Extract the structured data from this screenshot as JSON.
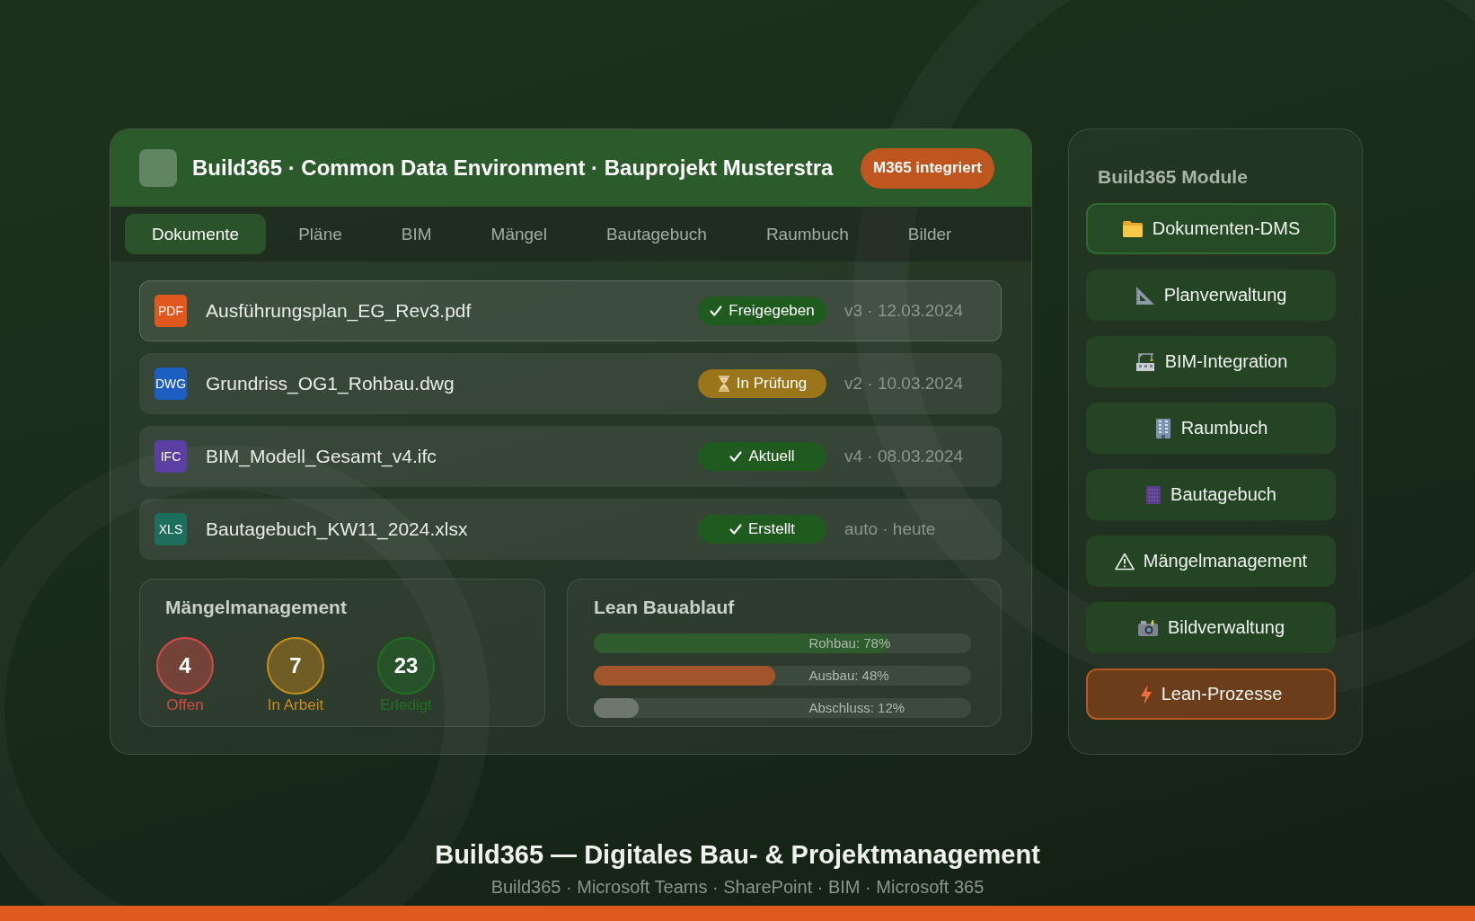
{
  "header": {
    "title": "Build365 · Common Data Environment · Bauprojekt Musterstra",
    "badge": "M365 integriert"
  },
  "tabs": [
    {
      "label": "Dokumente",
      "selected": true
    },
    {
      "label": "Pläne",
      "selected": false
    },
    {
      "label": "BIM",
      "selected": false
    },
    {
      "label": "Mängel",
      "selected": false
    },
    {
      "label": "Bautagebuch",
      "selected": false
    },
    {
      "label": "Raumbuch",
      "selected": false
    },
    {
      "label": "Bilder",
      "selected": false
    }
  ],
  "documents": [
    {
      "type_label": "PDF",
      "color": "#e0581e",
      "name": "Ausführungsplan_EG_Rev3.pdf",
      "status": {
        "kind": "done",
        "label": "Freigegeben"
      },
      "meta": "v3 · 12.03.2024",
      "selected": true
    },
    {
      "type_label": "DWG",
      "color": "#1c5fc0",
      "name": "Grundriss_OG1_Rohbau.dwg",
      "status": {
        "kind": "pending",
        "label": "In Prüfung"
      },
      "meta": "v2 · 10.03.2024",
      "selected": false
    },
    {
      "type_label": "IFC",
      "color": "#5b3fa2",
      "name": "BIM_Modell_Gesamt_v4.ifc",
      "status": {
        "kind": "done",
        "label": "Aktuell"
      },
      "meta": "v4 · 08.03.2024",
      "selected": false
    },
    {
      "type_label": "XLS",
      "color": "#1d6e5c",
      "name": "Bautagebuch_KW11_2024.xlsx",
      "status": {
        "kind": "done",
        "label": "Erstellt"
      },
      "meta": "auto · heute",
      "selected": false
    }
  ],
  "defects": {
    "title": "Mängelmanagement",
    "counters": [
      {
        "count": "4",
        "label": "Offen",
        "color": "#d44a48"
      },
      {
        "count": "7",
        "label": "In Arbeit",
        "color": "#c98d1a"
      },
      {
        "count": "23",
        "label": "Erledigt",
        "color": "#1f7022"
      }
    ]
  },
  "lean": {
    "title": "Lean Bauablauf",
    "bars": [
      {
        "label": "Rohbau: 78%",
        "level": 0.78,
        "color": "#2f5c2f"
      },
      {
        "label": "Ausbau: 48%",
        "level": 0.48,
        "color": "#a2552a"
      },
      {
        "label": "Abschluss: 12%",
        "level": 0.12,
        "color": "#6e776e"
      }
    ]
  },
  "sidebar": {
    "title": "Build365 Module",
    "items": [
      {
        "label": "Dokumenten-DMS",
        "selected": true,
        "highlighted": false
      },
      {
        "label": "Planverwaltung",
        "selected": false,
        "highlighted": false
      },
      {
        "label": "BIM-Integration",
        "selected": false,
        "highlighted": false
      },
      {
        "label": "Raumbuch",
        "selected": false,
        "highlighted": false
      },
      {
        "label": "Bautagebuch",
        "selected": false,
        "highlighted": false
      },
      {
        "label": "Mängelmanagement",
        "selected": false,
        "highlighted": false
      },
      {
        "label": "Bildverwaltung",
        "selected": false,
        "highlighted": false
      },
      {
        "label": "Lean-Prozesse",
        "selected": false,
        "highlighted": true
      }
    ]
  },
  "footer": {
    "title": "Build365 — Digitales Bau- & Projektmanagement",
    "subtitle": "Build365 · Microsoft Teams · SharePoint · BIM · Microsoft 365"
  }
}
